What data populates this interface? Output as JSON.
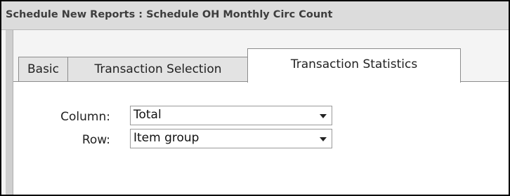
{
  "window": {
    "title": "Schedule New Reports : Schedule OH Monthly Circ Count"
  },
  "tabs": [
    {
      "label": "Basic",
      "active": false
    },
    {
      "label": "Transaction Selection",
      "active": false
    },
    {
      "label": "Transaction Statistics",
      "active": true
    }
  ],
  "form": {
    "column": {
      "label": "Column:",
      "value": "Total"
    },
    "row": {
      "label": "Row:",
      "value": "Item group"
    }
  }
}
